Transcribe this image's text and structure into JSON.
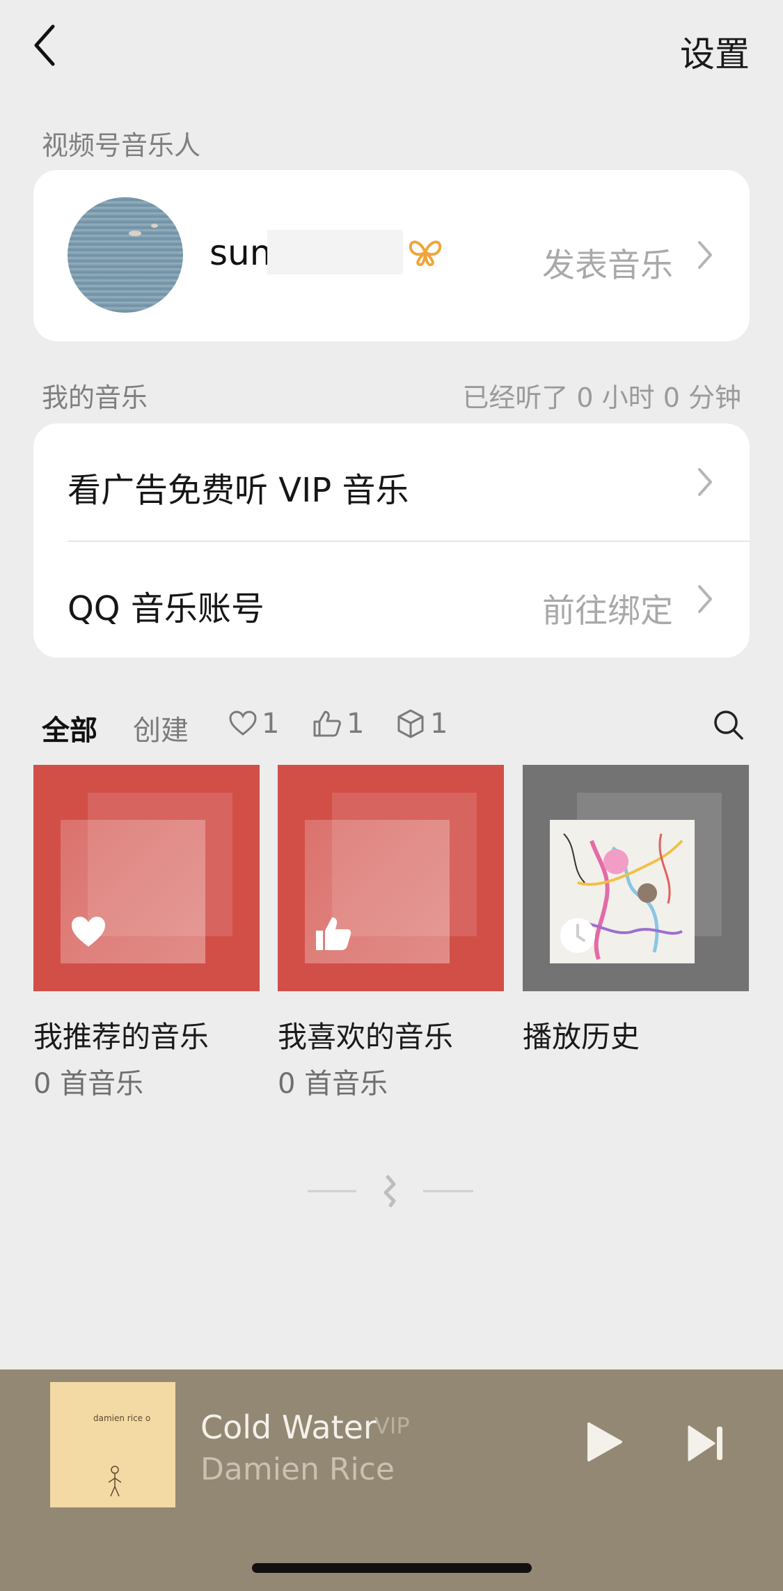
{
  "nav": {
    "settings_label": "设置"
  },
  "musician": {
    "section_label": "视频号音乐人",
    "username": "sun",
    "publish_label": "发表音乐"
  },
  "my_music": {
    "section_label": "我的音乐",
    "listen_time": "已经听了 0 小时 0 分钟",
    "rows": [
      {
        "title": "看广告免费听 VIP 音乐",
        "right": ""
      },
      {
        "title": "QQ 音乐账号",
        "right": "前往绑定"
      }
    ]
  },
  "tabs": [
    {
      "label": "全部",
      "icon": ""
    },
    {
      "label": "创建",
      "icon": ""
    },
    {
      "label": "1",
      "icon": "heart-icon"
    },
    {
      "label": "1",
      "icon": "thumbs-up-icon"
    },
    {
      "label": "1",
      "icon": "cube-icon"
    }
  ],
  "playlists": [
    {
      "title": "我推荐的音乐",
      "subtitle": "0 首音乐",
      "icon": "heart-icon",
      "color": "#d24f48"
    },
    {
      "title": "我喜欢的音乐",
      "subtitle": "0 首音乐",
      "icon": "thumbs-up-icon",
      "color": "#d24f48"
    },
    {
      "title": "播放历史",
      "subtitle": "",
      "icon": "clock-icon",
      "color": "#737373"
    }
  ],
  "player": {
    "song": "Cold Water",
    "vip_label": "VIP",
    "artist": "Damien Rice",
    "cover_text": "damien rice  o",
    "background": "#938873"
  }
}
